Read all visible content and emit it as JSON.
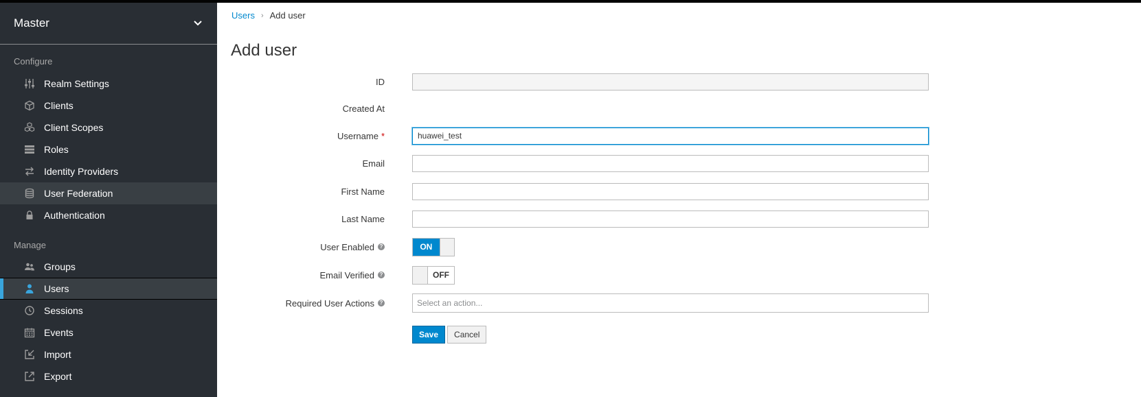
{
  "realm": {
    "name": "Master"
  },
  "sections": {
    "configure": "Configure",
    "manage": "Manage"
  },
  "configure_items": [
    {
      "label": "Realm Settings",
      "icon": "sliders-icon"
    },
    {
      "label": "Clients",
      "icon": "cube-icon"
    },
    {
      "label": "Client Scopes",
      "icon": "cubes-icon"
    },
    {
      "label": "Roles",
      "icon": "list-icon"
    },
    {
      "label": "Identity Providers",
      "icon": "exchange-icon"
    },
    {
      "label": "User Federation",
      "icon": "database-icon"
    },
    {
      "label": "Authentication",
      "icon": "lock-icon"
    }
  ],
  "manage_items": [
    {
      "label": "Groups",
      "icon": "users-icon"
    },
    {
      "label": "Users",
      "icon": "user-icon"
    },
    {
      "label": "Sessions",
      "icon": "clock-icon"
    },
    {
      "label": "Events",
      "icon": "calendar-icon"
    },
    {
      "label": "Import",
      "icon": "import-icon"
    },
    {
      "label": "Export",
      "icon": "export-icon"
    }
  ],
  "breadcrumb": {
    "parent": "Users",
    "current": "Add user"
  },
  "page": {
    "title": "Add user"
  },
  "form": {
    "id_label": "ID",
    "id_value": "",
    "created_label": "Created At",
    "username_label": "Username",
    "username_required": "*",
    "username_value": "huawei_test",
    "email_label": "Email",
    "email_value": "",
    "first_name_label": "First Name",
    "first_name_value": "",
    "last_name_label": "Last Name",
    "last_name_value": "",
    "user_enabled_label": "User Enabled",
    "user_enabled_state": "ON",
    "email_verified_label": "Email Verified",
    "email_verified_state": "OFF",
    "help_glyph": "?",
    "required_actions_label": "Required User Actions",
    "required_actions_placeholder": "Select an action...",
    "save_label": "Save",
    "cancel_label": "Cancel"
  },
  "colors": {
    "sidebar": "#292e34",
    "accent": "#0088ce",
    "active_marker": "#39a5dc"
  }
}
